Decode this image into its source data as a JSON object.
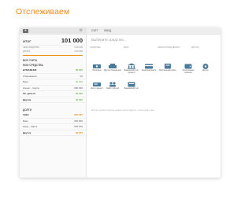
{
  "heading": "Отслеживаем",
  "sidebar": {
    "add_label": "+",
    "total_label": "ИТОГ",
    "total_value": "101 000",
    "sub": [
      {
        "label": "ЧЕМ СРЕДСТВА",
        "value": "0,00 000"
      },
      {
        "label": "ДОЛГИ",
        "value": "0,00 000"
      }
    ],
    "section_all": "ВСЕ СЧЕТА",
    "section_mine": "МОИ СРЕДСТВА",
    "accounts": [
      {
        "label": "БУМАЖНИК",
        "value": "00 000",
        "bold": true,
        "color": "green"
      },
      {
        "label": "Сбережения",
        "value": "00",
        "bold": false,
        "color": ""
      },
      {
        "label": "Банк",
        "value": "00 000",
        "bold": false,
        "color": "green"
      },
      {
        "label": "Кошел... Карта",
        "value": "000 000",
        "bold": false,
        "color": ""
      },
      {
        "label": "Эл. деньги",
        "value": "00 000",
        "bold": true,
        "color": "green"
      },
      {
        "label": "Другие",
        "value": "00 000",
        "bold": true,
        "color": "green"
      }
    ],
    "section_debts": "ДОЛГИ",
    "debts": [
      {
        "label": "Займ",
        "value": "000 000",
        "bold": true,
        "color": "orange"
      },
      {
        "label": "Банк",
        "value": "000 000",
        "bold": false,
        "color": ""
      },
      {
        "label": "Кред... Карта",
        "value": "000 000",
        "bold": false,
        "color": ""
      },
      {
        "label": "Другие",
        "value": "00 000",
        "bold": true,
        "color": "orange"
      }
    ]
  },
  "main": {
    "tabs": [
      "СЧЁТ",
      "ВВОД"
    ],
    "title": "Выберите средство...",
    "categories": [
      "НАЛИЧНЫЕ",
      "БАНК",
      "ЭЛЕКТРОННЫЕ ДЕНЬГИ",
      "ДРУГОЕ"
    ],
    "tiles": [
      {
        "label": "Наличные",
        "icon": "cash-icon"
      },
      {
        "label": "Другие сбережения",
        "icon": "savings-icon"
      },
      {
        "label": "Банковский счёт (кредит)",
        "icon": "bank-account-icon"
      },
      {
        "label": "Кредитная карта",
        "icon": "credit-card-icon"
      },
      {
        "label": "Виртуальная карта",
        "icon": "virtual-card-icon"
      },
      {
        "label": "Электронный кошелёк",
        "icon": "e-wallet-icon"
      },
      {
        "label": "Другое",
        "icon": "other-icon"
      },
      {
        "label": "Долг в кредит",
        "icon": "debt-icon"
      },
      {
        "label": "Займ у друзей",
        "icon": "loan-icon"
      },
      {
        "label": "Банковский счёт",
        "icon": "bank-icon"
      }
    ],
    "note": "Если нет нужного средства, нажмите кнопку «Другое», чтобы создать своё."
  },
  "colors": {
    "accent": "#f28a1e",
    "positive": "#6ab04c",
    "icon": "#4a7a9c"
  }
}
